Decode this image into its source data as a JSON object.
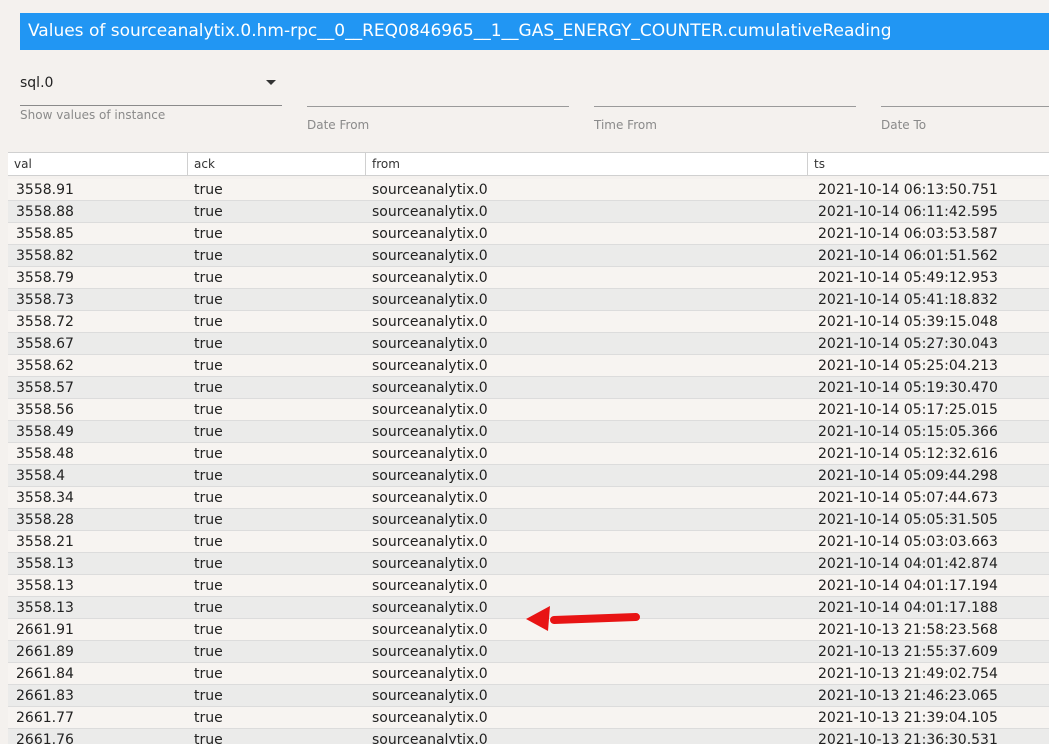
{
  "title": "Values of sourceanalytix.0.hm-rpc__0__REQ0846965__1__GAS_ENERGY_COUNTER.cumulativeReading",
  "filters": {
    "instance_value": "sql.0",
    "instance_helper": "Show values of instance",
    "date_from_label": "Date From",
    "time_from_label": "Time From",
    "date_to_label": "Date To"
  },
  "table": {
    "headers": [
      "val",
      "ack",
      "from",
      "ts"
    ],
    "rows": [
      {
        "val": "3558.91",
        "ack": "true",
        "from": "sourceanalytix.0",
        "ts": "2021-10-14 06:13:50.751"
      },
      {
        "val": "3558.88",
        "ack": "true",
        "from": "sourceanalytix.0",
        "ts": "2021-10-14 06:11:42.595"
      },
      {
        "val": "3558.85",
        "ack": "true",
        "from": "sourceanalytix.0",
        "ts": "2021-10-14 06:03:53.587"
      },
      {
        "val": "3558.82",
        "ack": "true",
        "from": "sourceanalytix.0",
        "ts": "2021-10-14 06:01:51.562"
      },
      {
        "val": "3558.79",
        "ack": "true",
        "from": "sourceanalytix.0",
        "ts": "2021-10-14 05:49:12.953"
      },
      {
        "val": "3558.73",
        "ack": "true",
        "from": "sourceanalytix.0",
        "ts": "2021-10-14 05:41:18.832"
      },
      {
        "val": "3558.72",
        "ack": "true",
        "from": "sourceanalytix.0",
        "ts": "2021-10-14 05:39:15.048"
      },
      {
        "val": "3558.67",
        "ack": "true",
        "from": "sourceanalytix.0",
        "ts": "2021-10-14 05:27:30.043"
      },
      {
        "val": "3558.62",
        "ack": "true",
        "from": "sourceanalytix.0",
        "ts": "2021-10-14 05:25:04.213"
      },
      {
        "val": "3558.57",
        "ack": "true",
        "from": "sourceanalytix.0",
        "ts": "2021-10-14 05:19:30.470"
      },
      {
        "val": "3558.56",
        "ack": "true",
        "from": "sourceanalytix.0",
        "ts": "2021-10-14 05:17:25.015"
      },
      {
        "val": "3558.49",
        "ack": "true",
        "from": "sourceanalytix.0",
        "ts": "2021-10-14 05:15:05.366"
      },
      {
        "val": "3558.48",
        "ack": "true",
        "from": "sourceanalytix.0",
        "ts": "2021-10-14 05:12:32.616"
      },
      {
        "val": "3558.4",
        "ack": "true",
        "from": "sourceanalytix.0",
        "ts": "2021-10-14 05:09:44.298"
      },
      {
        "val": "3558.34",
        "ack": "true",
        "from": "sourceanalytix.0",
        "ts": "2021-10-14 05:07:44.673"
      },
      {
        "val": "3558.28",
        "ack": "true",
        "from": "sourceanalytix.0",
        "ts": "2021-10-14 05:05:31.505"
      },
      {
        "val": "3558.21",
        "ack": "true",
        "from": "sourceanalytix.0",
        "ts": "2021-10-14 05:03:03.663"
      },
      {
        "val": "3558.13",
        "ack": "true",
        "from": "sourceanalytix.0",
        "ts": "2021-10-14 04:01:42.874"
      },
      {
        "val": "3558.13",
        "ack": "true",
        "from": "sourceanalytix.0",
        "ts": "2021-10-14 04:01:17.194"
      },
      {
        "val": "3558.13",
        "ack": "true",
        "from": "sourceanalytix.0",
        "ts": "2021-10-14 04:01:17.188"
      },
      {
        "val": "2661.91",
        "ack": "true",
        "from": "sourceanalytix.0",
        "ts": "2021-10-13 21:58:23.568"
      },
      {
        "val": "2661.89",
        "ack": "true",
        "from": "sourceanalytix.0",
        "ts": "2021-10-13 21:55:37.609"
      },
      {
        "val": "2661.84",
        "ack": "true",
        "from": "sourceanalytix.0",
        "ts": "2021-10-13 21:49:02.754"
      },
      {
        "val": "2661.83",
        "ack": "true",
        "from": "sourceanalytix.0",
        "ts": "2021-10-13 21:46:23.065"
      },
      {
        "val": "2661.77",
        "ack": "true",
        "from": "sourceanalytix.0",
        "ts": "2021-10-13 21:39:04.105"
      },
      {
        "val": "2661.76",
        "ack": "true",
        "from": "sourceanalytix.0",
        "ts": "2021-10-13 21:36:30.531"
      }
    ]
  },
  "annotation": {
    "arrow_color": "#e81414"
  }
}
